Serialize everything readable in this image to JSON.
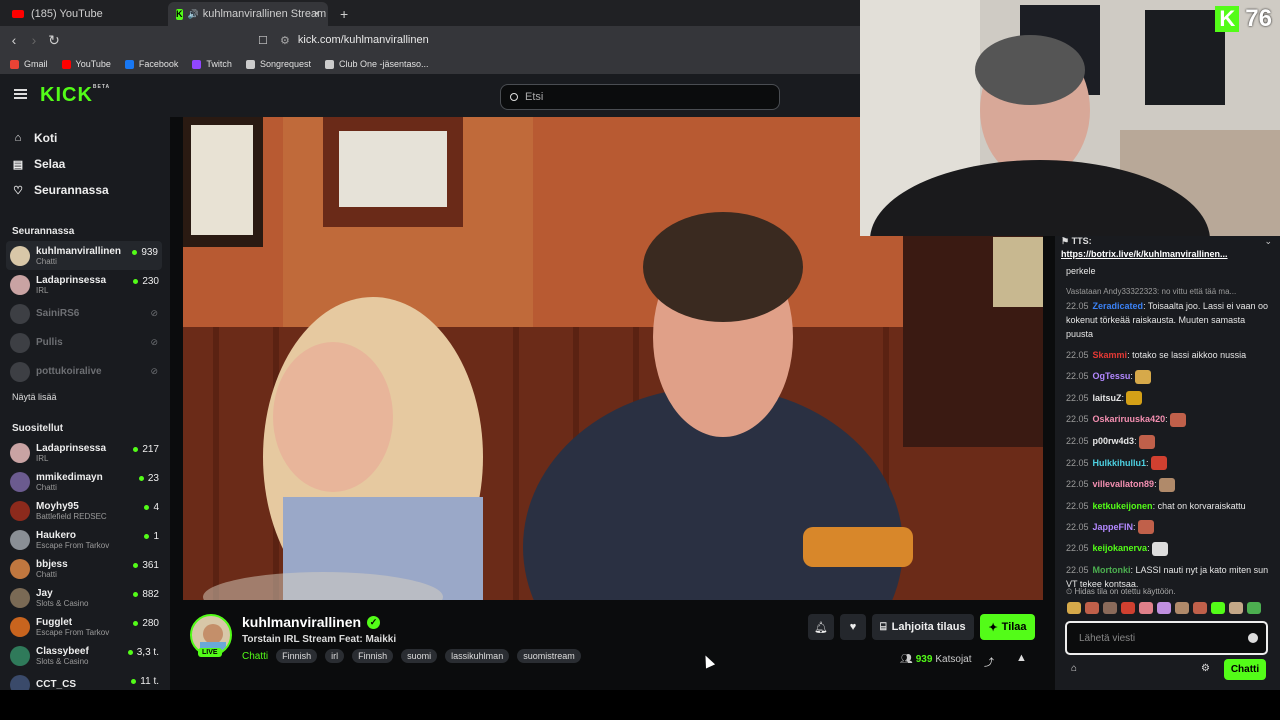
{
  "browser": {
    "tabs": [
      {
        "title": "(185) YouTube",
        "icon": "youtube-icon"
      },
      {
        "title": "kuhlmanvirallinen Stream - W",
        "icon": "kick-icon"
      }
    ],
    "new_tab": "+",
    "close": "×",
    "url": "kick.com/kuhlmanvirallinen",
    "bookmarks": [
      {
        "label": "Gmail",
        "color": "#ea4335"
      },
      {
        "label": "YouTube",
        "color": "#ff0000"
      },
      {
        "label": "Facebook",
        "color": "#1877f2"
      },
      {
        "label": "Twitch",
        "color": "#9146ff"
      },
      {
        "label": "Songrequest",
        "color": "#cccccc"
      },
      {
        "label": "Club One -jäsentaso...",
        "color": "#cccccc"
      }
    ]
  },
  "header": {
    "logo": "KICK",
    "logo_badge": "BETA",
    "search_placeholder": "Etsi"
  },
  "sidebar": {
    "nav": [
      {
        "label": "Koti",
        "icon": "home-icon"
      },
      {
        "label": "Selaa",
        "icon": "browse-icon"
      },
      {
        "label": "Seurannassa",
        "icon": "heart-icon"
      }
    ],
    "following_title": "Seurannassa",
    "following": [
      {
        "name": "kuhlmanvirallinen",
        "category": "Chatti",
        "viewers": "939",
        "color": "#d8c7a8"
      },
      {
        "name": "Ladaprinsessa",
        "category": "IRL",
        "viewers": "230",
        "color": "#c9a3a3"
      },
      {
        "name": "SainiRS6",
        "category": "",
        "viewers": "",
        "color": "#55585d"
      },
      {
        "name": "Pullis",
        "category": "",
        "viewers": "",
        "color": "#55585d"
      },
      {
        "name": "pottukoiralive",
        "category": "",
        "viewers": "",
        "color": "#55585d"
      }
    ],
    "show_more": "Näytä lisää",
    "recommended_title": "Suositellut",
    "recommended": [
      {
        "name": "Ladaprinsessa",
        "category": "IRL",
        "viewers": "217",
        "color": "#c9a3a3"
      },
      {
        "name": "mmikedimayn",
        "category": "Chatti",
        "viewers": "23",
        "color": "#6b5b8f"
      },
      {
        "name": "Moyhy95",
        "category": "Battlefield REDSEC",
        "viewers": "4",
        "color": "#8c2a1c"
      },
      {
        "name": "Haukero",
        "category": "Escape From Tarkov",
        "viewers": "1",
        "color": "#8a8f95"
      },
      {
        "name": "bbjess",
        "category": "Chatti",
        "viewers": "361",
        "color": "#c0773f"
      },
      {
        "name": "Jay",
        "category": "Slots & Casino",
        "viewers": "882",
        "color": "#7a6a55"
      },
      {
        "name": "Fugglet",
        "category": "Escape From Tarkov",
        "viewers": "280",
        "color": "#c8641e"
      },
      {
        "name": "Classybeef",
        "category": "Slots & Casino",
        "viewers": "3,3 t.",
        "color": "#2f7a5a"
      },
      {
        "name": "CCT_CS",
        "category": "",
        "viewers": "11 t.",
        "color": "#3a4a6a"
      }
    ]
  },
  "overlay": {
    "kick_letter": "K",
    "count": "76"
  },
  "stream": {
    "channel": "kuhlmanvirallinen",
    "live": "LIVE",
    "title": "Torstain IRL Stream Feat: Maikki",
    "category": "Chatti",
    "tags": [
      "Finnish",
      "irl",
      "Finnish",
      "suomi",
      "lassikuhlman",
      "suomistream"
    ],
    "gift_label": "Lahjoita tilaus",
    "subscribe_label": "Tilaa",
    "viewers_count": "939",
    "viewers_label": "Katsojat"
  },
  "chat": {
    "pinned_label": "TTS:",
    "pinned_link": "https://botrix.live/k/kuhlmanvirallinen...",
    "messages": [
      {
        "time": "",
        "user": "",
        "text": "perkele",
        "color": "#e6e6e6"
      },
      {
        "reply": "Vastataan Andy33322323: no vittu että tää ma...",
        "time": "22.05",
        "user": "Zeradicated",
        "text": ": Toisaalta joo. Lassi ei vaan oo kokenut törkeää raiskausta. Muuten samasta puusta",
        "color": "#3b82f6"
      },
      {
        "time": "22.05",
        "user": "Skammi",
        "text": ": totako se lassi aikkoo nussia",
        "color": "#e53935"
      },
      {
        "time": "22.05",
        "user": "OgTessu",
        "text": ":",
        "color": "#b388ff",
        "emote": "#d6a94a"
      },
      {
        "time": "22.05",
        "user": "laitsuZ",
        "text": ":",
        "color": "#e6e6e6",
        "emote": "#d4a017"
      },
      {
        "time": "22.05",
        "user": "Oskariruuska420",
        "text": ":",
        "color": "#f48fb1",
        "emote": "#c0604a"
      },
      {
        "time": "22.05",
        "user": "p00rw4d3",
        "text": ":",
        "color": "#e6e6e6",
        "emote": "#c0604a"
      },
      {
        "time": "22.05",
        "user": "Hulkkihullu1",
        "text": ":",
        "color": "#4dd0e1",
        "emote": "#d04030"
      },
      {
        "time": "22.05",
        "user": "villevallaton89",
        "text": ":",
        "color": "#f48fb1",
        "emote": "#b08a6a"
      },
      {
        "time": "22.05",
        "user": "ketkukeijonen",
        "text": ": chat on korvaraiskattu",
        "color": "#53fc18"
      },
      {
        "time": "22.05",
        "user": "JappeFIN",
        "text": ":",
        "color": "#b388ff",
        "emote": "#c0604a"
      },
      {
        "time": "22.05",
        "user": "keijokanerva",
        "text": ":",
        "color": "#53fc18",
        "emote": "#dddddd"
      },
      {
        "time": "22.05",
        "user": "Mortonki",
        "text": ": LASSI nauti nyt ja kato miten sun VT tekee kontsaa.",
        "color": "#4caf50"
      }
    ],
    "slow_mode": "Hidas tila on otettu käyttöön.",
    "input_placeholder": "Lähetä viesti",
    "send_label": "Chatti"
  }
}
